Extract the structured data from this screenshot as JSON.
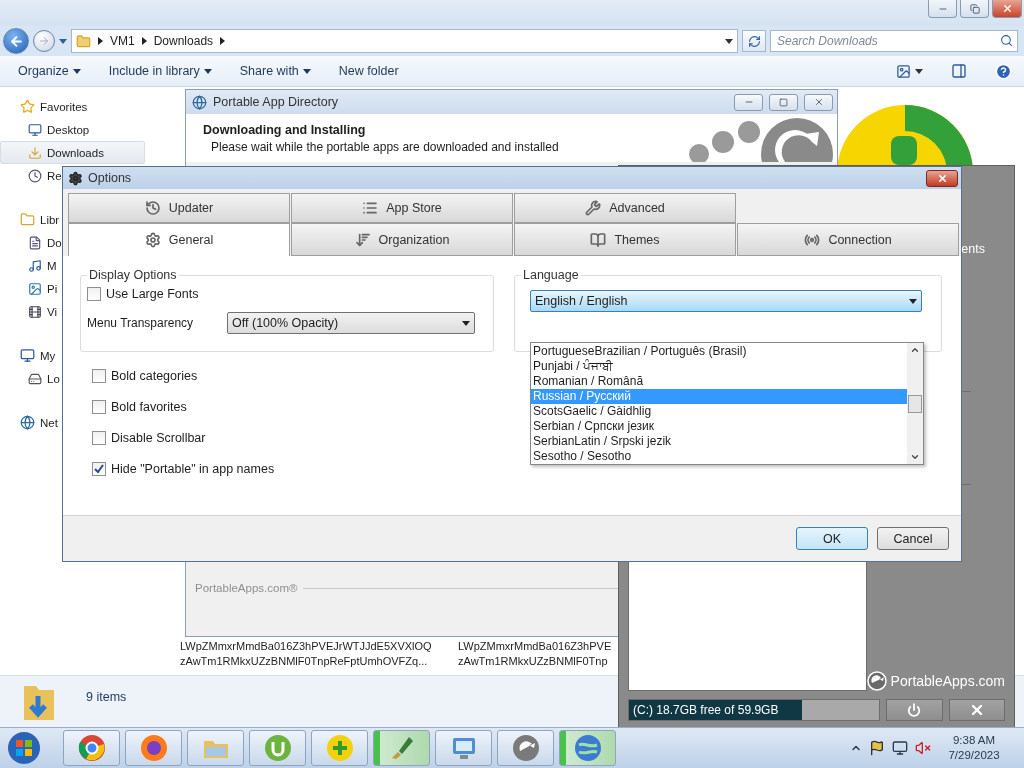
{
  "explorer": {
    "crumbs": [
      "VM1",
      "Downloads"
    ],
    "search": {
      "placeholder": "Search Downloads"
    },
    "toolbar": [
      {
        "label": "Organize",
        "dropdown": true
      },
      {
        "label": "Include in library",
        "dropdown": true
      },
      {
        "label": "Share with",
        "dropdown": true
      },
      {
        "label": "New folder",
        "dropdown": false
      }
    ],
    "sidebar": [
      {
        "label": "Favorites",
        "kind": "favorites",
        "children": [
          {
            "label": "Desktop",
            "kind": "desktop",
            "selected": false
          },
          {
            "label": "Downloads",
            "kind": "downloads",
            "selected": true
          },
          {
            "label": "Re",
            "kind": "recent",
            "selected": false
          }
        ]
      },
      {
        "label": "Libr",
        "kind": "libraries",
        "children": [
          {
            "label": "Do",
            "kind": "documents",
            "selected": false
          },
          {
            "label": "M",
            "kind": "music",
            "selected": false
          },
          {
            "label": "Pi",
            "kind": "pictures",
            "selected": false
          },
          {
            "label": "Vi",
            "kind": "videos",
            "selected": false
          }
        ]
      },
      {
        "label": "My",
        "kind": "computer",
        "children": [
          {
            "label": "Lo",
            "kind": "disk",
            "selected": false
          }
        ]
      },
      {
        "label": "Net",
        "kind": "network"
      }
    ],
    "files": [
      {
        "lines": [
          "LWpZMmxrMmdBa016Z3hPVEJrWTJJdE5XVXlOQ",
          "zAwTm1RMkxUZzBNMlF0TnpReFptUmhOVFZq..."
        ]
      },
      {
        "lines": [
          "LWpZMmxrMmdBa016Z3hPVE",
          "zAwTm1RMkxUZzBNMlF0Tnp"
        ]
      }
    ],
    "status": "9 items"
  },
  "directory_window": {
    "title": "Portable App Directory",
    "heading": "Downloading and Installing",
    "message": "Please wait while the portable apps are downloaded and installed",
    "footer": "PortableApps.com®"
  },
  "menu_panel": {
    "button_fragment": "ents",
    "brand": "PortableApps.com",
    "drive": {
      "label": "(C:) 18.7GB free of 59.9GB",
      "level": 0.69
    }
  },
  "options": {
    "title": "Options",
    "tab_rows": [
      [
        {
          "label": "Updater",
          "kind": "updater",
          "selected": false
        },
        {
          "label": "App Store",
          "kind": "store",
          "selected": false
        },
        {
          "label": "Advanced",
          "kind": "advanced",
          "selected": false
        }
      ],
      [
        {
          "label": "General",
          "kind": "general",
          "selected": true
        },
        {
          "label": "Organization",
          "kind": "organization",
          "selected": false
        },
        {
          "label": "Themes",
          "kind": "themes",
          "selected": false
        },
        {
          "label": "Connection",
          "kind": "connection",
          "selected": false
        }
      ]
    ],
    "display_options": {
      "legend": "Display Options",
      "large_fonts": {
        "label": "Use Large Fonts",
        "checked": false
      },
      "transparency": {
        "label": "Menu Transparency",
        "value": "Off (100% Opacity)"
      }
    },
    "checkboxes": [
      {
        "label": "Bold categories",
        "checked": false
      },
      {
        "label": "Bold favorites",
        "checked": false
      },
      {
        "label": "Disable Scrollbar",
        "checked": false
      },
      {
        "label": "Hide \"Portable\" in app names",
        "checked": true
      }
    ],
    "language": {
      "legend": "Language",
      "value": "English / English",
      "open": true,
      "options": [
        {
          "label": "PortugueseBrazilian / Português (Brasil)",
          "selected": false
        },
        {
          "label": "Punjabi / ਪੰਜਾਬੀ",
          "selected": false
        },
        {
          "label": "Romanian / Română",
          "selected": false
        },
        {
          "label": "Russian / Русский",
          "selected": true
        },
        {
          "label": "ScotsGaelic / Gàidhlig",
          "selected": false
        },
        {
          "label": "Serbian / Српски језик",
          "selected": false
        },
        {
          "label": "SerbianLatin / Srpski jezik",
          "selected": false
        },
        {
          "label": "Sesotho / Sesotho",
          "selected": false
        }
      ]
    },
    "buttons": [
      {
        "label": "OK",
        "default": true
      },
      {
        "label": "Cancel",
        "default": false
      }
    ]
  },
  "taskbar": {
    "apps": [
      {
        "kind": "chrome",
        "highlighted": false
      },
      {
        "kind": "firefox",
        "highlighted": false
      },
      {
        "kind": "folder",
        "highlighted": false
      },
      {
        "kind": "torrent",
        "highlighted": false
      },
      {
        "kind": "plus",
        "highlighted": false
      },
      {
        "kind": "paint",
        "highlighted": true
      },
      {
        "kind": "control",
        "highlighted": false
      },
      {
        "kind": "portable",
        "highlighted": false
      },
      {
        "kind": "globe",
        "highlighted": true
      }
    ],
    "clock": {
      "time": "9:38 AM",
      "date": "7/29/2023"
    }
  }
}
